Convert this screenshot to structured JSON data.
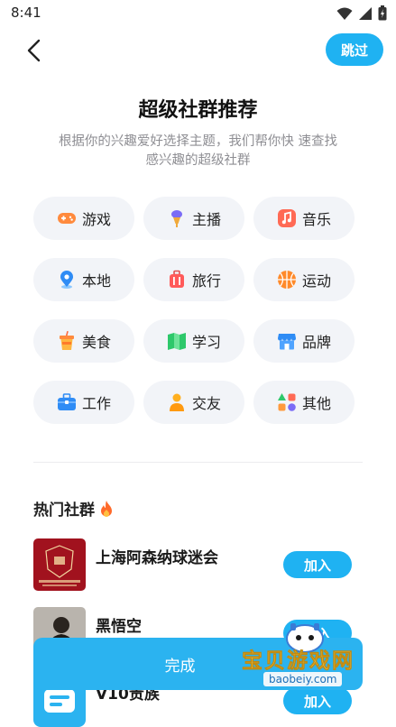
{
  "status_bar": {
    "time": "8:41"
  },
  "header": {
    "skip_label": "跳过"
  },
  "title": "超级社群推荐",
  "subtitle": "根据你的兴趣爱好选择主题，我们帮你快 速查找感兴趣的超级社群",
  "topics": [
    {
      "label": "游戏",
      "icon": "gamepad-icon"
    },
    {
      "label": "主播",
      "icon": "microphone-icon"
    },
    {
      "label": "音乐",
      "icon": "music-icon"
    },
    {
      "label": "本地",
      "icon": "location-icon"
    },
    {
      "label": "旅行",
      "icon": "luggage-icon"
    },
    {
      "label": "运动",
      "icon": "basketball-icon"
    },
    {
      "label": "美食",
      "icon": "drink-icon"
    },
    {
      "label": "学习",
      "icon": "book-icon"
    },
    {
      "label": "品牌",
      "icon": "shop-icon"
    },
    {
      "label": "工作",
      "icon": "briefcase-icon"
    },
    {
      "label": "交友",
      "icon": "person-icon"
    },
    {
      "label": "其他",
      "icon": "shapes-icon"
    }
  ],
  "hot": {
    "title": "热门社群",
    "communities": [
      {
        "name": "上海阿森纳球迷会",
        "join_label": "加入"
      },
      {
        "name": "黑悟空",
        "join_label": "加入"
      },
      {
        "name": "V10贵族",
        "join_label": "加入"
      }
    ]
  },
  "done_label": "完成",
  "watermark": {
    "text": "宝贝游戏网",
    "url": "baobeiy.com"
  },
  "colors": {
    "accent": "#1fb2f2",
    "chip_bg": "#f2f4f8",
    "subtitle": "#8e8e93"
  }
}
